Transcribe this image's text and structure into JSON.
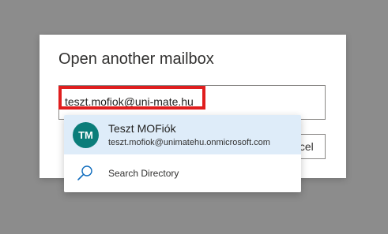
{
  "dialog": {
    "title": "Open another mailbox",
    "input_value": "teszt.mofiok@uni-mate.hu",
    "cancel_label": "Cancel",
    "highlight_color": "#e01e1e"
  },
  "suggestions": {
    "person": {
      "initials": "TM",
      "name": "Teszt MOFiók",
      "email": "teszt.mofiok@unimatehu.onmicrosoft.com",
      "avatar_color": "#0b7d7a",
      "highlight_color": "#deecf9"
    },
    "search": {
      "icon": "search-icon",
      "label": "Search Directory"
    }
  }
}
